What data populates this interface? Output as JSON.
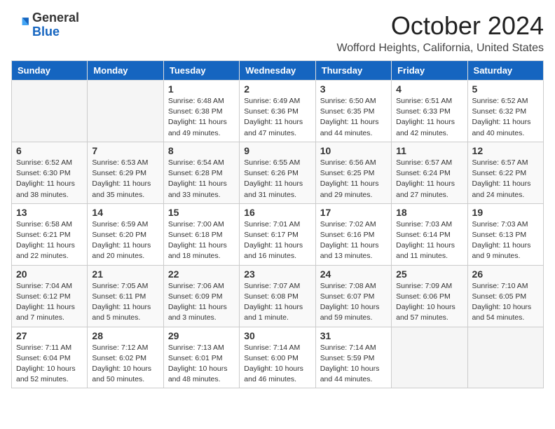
{
  "header": {
    "logo": {
      "general": "General",
      "blue": "Blue"
    },
    "title": "October 2024",
    "location": "Wofford Heights, California, United States"
  },
  "days_of_week": [
    "Sunday",
    "Monday",
    "Tuesday",
    "Wednesday",
    "Thursday",
    "Friday",
    "Saturday"
  ],
  "weeks": [
    [
      {
        "day": "",
        "info": ""
      },
      {
        "day": "",
        "info": ""
      },
      {
        "day": "1",
        "info": "Sunrise: 6:48 AM\nSunset: 6:38 PM\nDaylight: 11 hours and 49 minutes."
      },
      {
        "day": "2",
        "info": "Sunrise: 6:49 AM\nSunset: 6:36 PM\nDaylight: 11 hours and 47 minutes."
      },
      {
        "day": "3",
        "info": "Sunrise: 6:50 AM\nSunset: 6:35 PM\nDaylight: 11 hours and 44 minutes."
      },
      {
        "day": "4",
        "info": "Sunrise: 6:51 AM\nSunset: 6:33 PM\nDaylight: 11 hours and 42 minutes."
      },
      {
        "day": "5",
        "info": "Sunrise: 6:52 AM\nSunset: 6:32 PM\nDaylight: 11 hours and 40 minutes."
      }
    ],
    [
      {
        "day": "6",
        "info": "Sunrise: 6:52 AM\nSunset: 6:30 PM\nDaylight: 11 hours and 38 minutes."
      },
      {
        "day": "7",
        "info": "Sunrise: 6:53 AM\nSunset: 6:29 PM\nDaylight: 11 hours and 35 minutes."
      },
      {
        "day": "8",
        "info": "Sunrise: 6:54 AM\nSunset: 6:28 PM\nDaylight: 11 hours and 33 minutes."
      },
      {
        "day": "9",
        "info": "Sunrise: 6:55 AM\nSunset: 6:26 PM\nDaylight: 11 hours and 31 minutes."
      },
      {
        "day": "10",
        "info": "Sunrise: 6:56 AM\nSunset: 6:25 PM\nDaylight: 11 hours and 29 minutes."
      },
      {
        "day": "11",
        "info": "Sunrise: 6:57 AM\nSunset: 6:24 PM\nDaylight: 11 hours and 27 minutes."
      },
      {
        "day": "12",
        "info": "Sunrise: 6:57 AM\nSunset: 6:22 PM\nDaylight: 11 hours and 24 minutes."
      }
    ],
    [
      {
        "day": "13",
        "info": "Sunrise: 6:58 AM\nSunset: 6:21 PM\nDaylight: 11 hours and 22 minutes."
      },
      {
        "day": "14",
        "info": "Sunrise: 6:59 AM\nSunset: 6:20 PM\nDaylight: 11 hours and 20 minutes."
      },
      {
        "day": "15",
        "info": "Sunrise: 7:00 AM\nSunset: 6:18 PM\nDaylight: 11 hours and 18 minutes."
      },
      {
        "day": "16",
        "info": "Sunrise: 7:01 AM\nSunset: 6:17 PM\nDaylight: 11 hours and 16 minutes."
      },
      {
        "day": "17",
        "info": "Sunrise: 7:02 AM\nSunset: 6:16 PM\nDaylight: 11 hours and 13 minutes."
      },
      {
        "day": "18",
        "info": "Sunrise: 7:03 AM\nSunset: 6:14 PM\nDaylight: 11 hours and 11 minutes."
      },
      {
        "day": "19",
        "info": "Sunrise: 7:03 AM\nSunset: 6:13 PM\nDaylight: 11 hours and 9 minutes."
      }
    ],
    [
      {
        "day": "20",
        "info": "Sunrise: 7:04 AM\nSunset: 6:12 PM\nDaylight: 11 hours and 7 minutes."
      },
      {
        "day": "21",
        "info": "Sunrise: 7:05 AM\nSunset: 6:11 PM\nDaylight: 11 hours and 5 minutes."
      },
      {
        "day": "22",
        "info": "Sunrise: 7:06 AM\nSunset: 6:09 PM\nDaylight: 11 hours and 3 minutes."
      },
      {
        "day": "23",
        "info": "Sunrise: 7:07 AM\nSunset: 6:08 PM\nDaylight: 11 hours and 1 minute."
      },
      {
        "day": "24",
        "info": "Sunrise: 7:08 AM\nSunset: 6:07 PM\nDaylight: 10 hours and 59 minutes."
      },
      {
        "day": "25",
        "info": "Sunrise: 7:09 AM\nSunset: 6:06 PM\nDaylight: 10 hours and 57 minutes."
      },
      {
        "day": "26",
        "info": "Sunrise: 7:10 AM\nSunset: 6:05 PM\nDaylight: 10 hours and 54 minutes."
      }
    ],
    [
      {
        "day": "27",
        "info": "Sunrise: 7:11 AM\nSunset: 6:04 PM\nDaylight: 10 hours and 52 minutes."
      },
      {
        "day": "28",
        "info": "Sunrise: 7:12 AM\nSunset: 6:02 PM\nDaylight: 10 hours and 50 minutes."
      },
      {
        "day": "29",
        "info": "Sunrise: 7:13 AM\nSunset: 6:01 PM\nDaylight: 10 hours and 48 minutes."
      },
      {
        "day": "30",
        "info": "Sunrise: 7:14 AM\nSunset: 6:00 PM\nDaylight: 10 hours and 46 minutes."
      },
      {
        "day": "31",
        "info": "Sunrise: 7:14 AM\nSunset: 5:59 PM\nDaylight: 10 hours and 44 minutes."
      },
      {
        "day": "",
        "info": ""
      },
      {
        "day": "",
        "info": ""
      }
    ]
  ]
}
